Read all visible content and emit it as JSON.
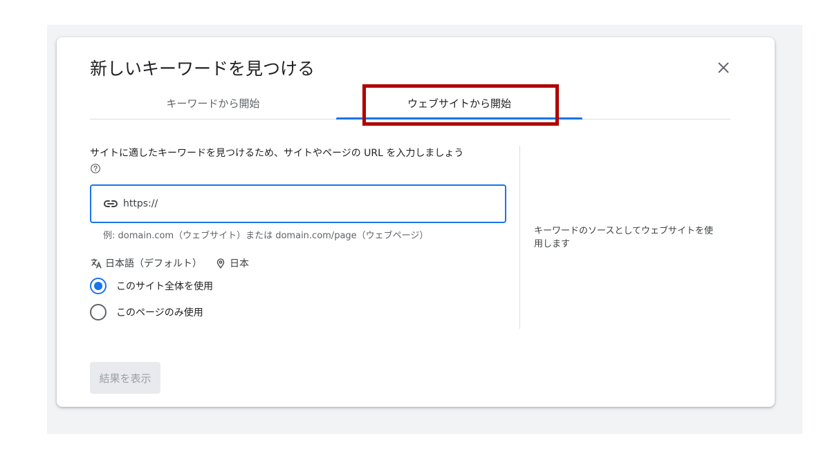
{
  "dialog": {
    "title": "新しいキーワードを見つける",
    "close_icon": "close-icon"
  },
  "tabs": [
    {
      "label": "キーワードから開始",
      "selected": false
    },
    {
      "label": "ウェブサイトから開始",
      "selected": true
    }
  ],
  "form": {
    "prompt": "サイトに適したキーワードを見つけるため、サイトやページの URL を入力しましょう",
    "help_icon": "help-icon",
    "url_field": {
      "icon": "link-icon",
      "value": "",
      "placeholder": "https://"
    },
    "hint": "例: domain.com（ウェブサイト）または domain.com/page（ウェブページ）",
    "language": {
      "icon": "translate-icon",
      "label": "日本語（デフォルト）"
    },
    "location": {
      "icon": "location-pin-icon",
      "label": "日本"
    },
    "scope_options": [
      {
        "label": "このサイト全体を使用",
        "selected": true
      },
      {
        "label": "このページのみ使用",
        "selected": false
      }
    ]
  },
  "side_note": "キーワードのソースとしてウェブサイトを使用します",
  "actions": {
    "submit_label": "結果を表示",
    "submit_enabled": false
  },
  "colors": {
    "accent": "#1a73e8",
    "highlight_frame": "#b00000",
    "disabled_bg": "#e8eaed"
  }
}
